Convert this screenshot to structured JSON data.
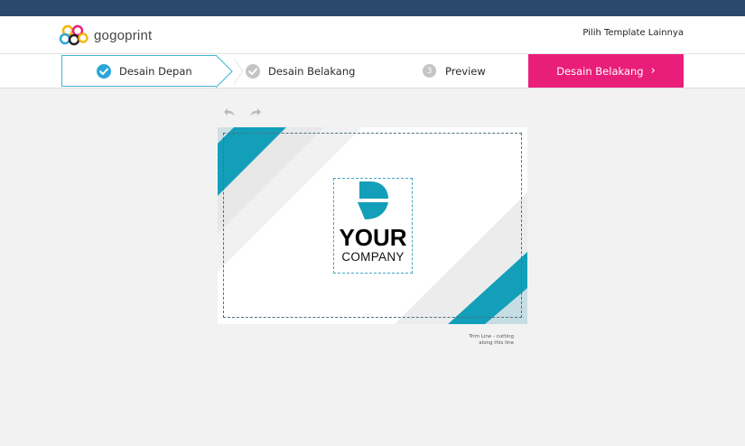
{
  "brand": {
    "name": "gogoprint"
  },
  "header": {
    "template_link": "Pilih Template Lainnya"
  },
  "steps": {
    "front": {
      "label": "Desain Depan"
    },
    "back": {
      "label": "Desain Belakang"
    },
    "preview": {
      "number": "3",
      "label": "Preview"
    }
  },
  "next_button": {
    "label": "Desain Belakang",
    "chevron": "›"
  },
  "toolbar": {
    "undo_icon": "undo-icon",
    "redo_icon": "redo-icon"
  },
  "card": {
    "logo_word1": "YOUR",
    "logo_word2": "COMPANY",
    "accent_color": "#139fb9"
  },
  "trim_caption": {
    "line1": "Trim Line - cutting",
    "line2": "along this line"
  },
  "colors": {
    "topbar": "#2b4a6b",
    "accent_pink": "#e91e7a",
    "active_step_border": "#3fb3d3",
    "check_blue": "#2aa7d8"
  }
}
